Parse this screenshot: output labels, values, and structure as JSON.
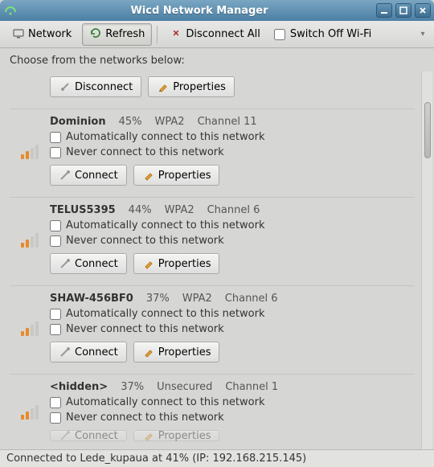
{
  "window": {
    "title": "Wicd Network Manager"
  },
  "toolbar": {
    "network": "Network",
    "refresh": "Refresh",
    "disconnect_all": "Disconnect All",
    "switch_off_wifi": "Switch Off Wi-Fi"
  },
  "prompt": "Choose from the networks below:",
  "labels": {
    "auto_connect": "Automatically connect to this network",
    "never_connect": "Never connect to this network",
    "connect": "Connect",
    "disconnect": "Disconnect",
    "properties": "Properties"
  },
  "current_connection": {
    "buttons": {
      "disconnect": true,
      "properties": true
    }
  },
  "networks": [
    {
      "name": "Dominion",
      "strength": "45%",
      "security": "WPA2",
      "channel": "Channel 11",
      "bars": 2
    },
    {
      "name": "TELUS5395",
      "strength": "44%",
      "security": "WPA2",
      "channel": "Channel 6",
      "bars": 2
    },
    {
      "name": "SHAW-456BF0",
      "strength": "37%",
      "security": "WPA2",
      "channel": "Channel 6",
      "bars": 2
    },
    {
      "name": "<hidden>",
      "strength": "37%",
      "security": "Unsecured",
      "channel": "Channel 1",
      "bars": 2
    }
  ],
  "status": "Connected to Lede_kupaua at 41% (IP: 192.168.215.145)"
}
